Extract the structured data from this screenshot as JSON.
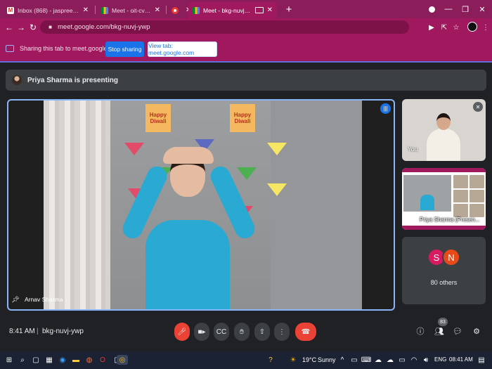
{
  "browser": {
    "tabs": [
      {
        "label": "Inbox (868) - jaspreet.k@theindi",
        "icon": "gmail-icon",
        "active": false
      },
      {
        "label": "Meet - oit-cvtj-dxt",
        "icon": "meet-icon",
        "active": false
      },
      {
        "label": "",
        "icon": "recording-icon",
        "active": false
      },
      {
        "label": "Meet - bkg-nuvj-ywp",
        "icon": "meet-icon",
        "active": true
      }
    ],
    "url": "meet.google.com/bkg-nuvj-ywp",
    "new_tab": "+"
  },
  "sharing_bar": {
    "text": "Sharing this tab to meet.google.com",
    "stop_label": "Stop sharing",
    "view_label": "View tab: meet.google.com"
  },
  "presenting": {
    "text": "Priya Sharma is presenting"
  },
  "main_video": {
    "name": "Arnav Sharma",
    "banner_text_1": "Happy Diwali",
    "banner_text_2": "Happy Diwali"
  },
  "tiles": {
    "you_label": "You",
    "presentation_label": "Priya Sharma (Presen...",
    "avatars": [
      "S",
      "N"
    ],
    "others_label": "80 others"
  },
  "controls": {
    "time": "8:41 AM",
    "separator": "|",
    "meeting_code": "bkg-nuvj-ywp",
    "participants_count": "83"
  },
  "taskbar": {
    "weather_temp": "19°C",
    "weather_desc": "Sunny",
    "language": "ENG",
    "clock": "08:41 AM"
  },
  "colors": {
    "accent": "#a0195e",
    "meet_dark": "#202124",
    "leave_red": "#ea4335",
    "google_blue": "#1a73e8"
  }
}
